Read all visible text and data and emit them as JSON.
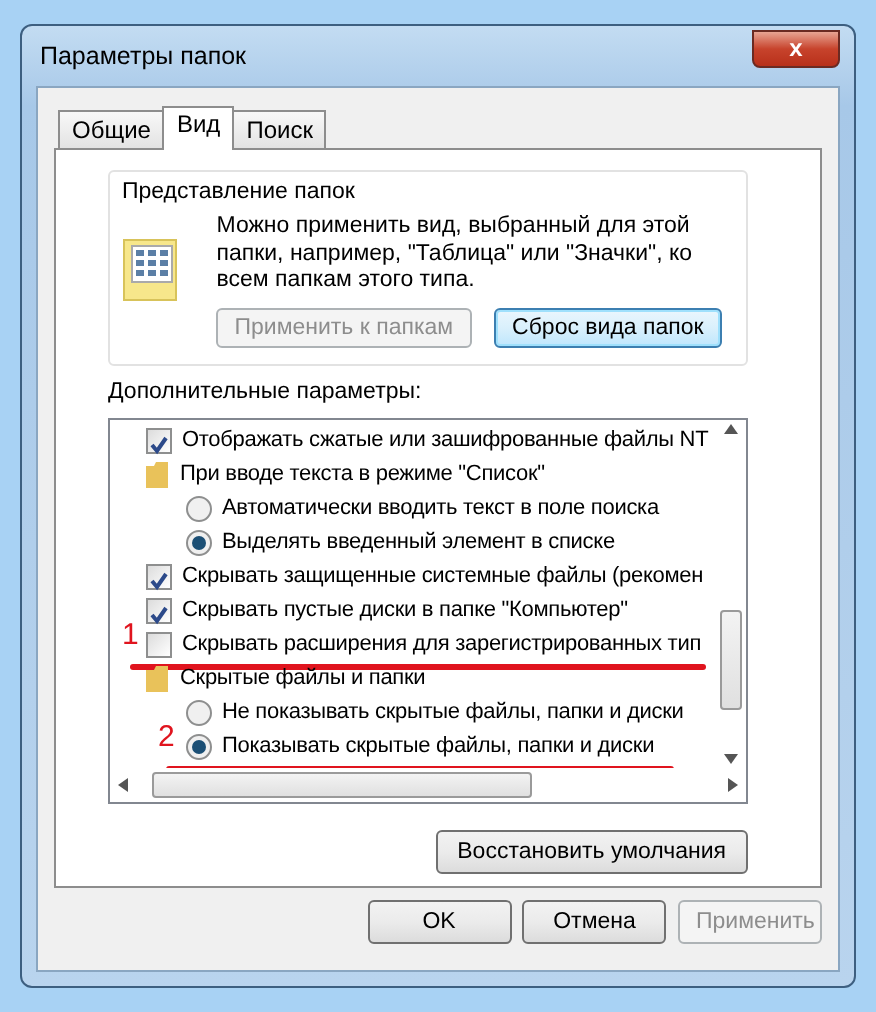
{
  "window": {
    "title": "Параметры папок",
    "close": "x"
  },
  "tabs": [
    {
      "label": "Общие",
      "selected": false
    },
    {
      "label": "Вид",
      "selected": true
    },
    {
      "label": "Поиск",
      "selected": false
    }
  ],
  "folder_views": {
    "title": "Представление папок",
    "text": "Можно применить вид, выбранный для этой папки, например, \"Таблица\" или \"Значки\", ко всем папкам этого типа.",
    "buttons": [
      {
        "label": "Применить к папкам",
        "disabled": true
      },
      {
        "label": "Сброс вида папок",
        "disabled": false
      }
    ]
  },
  "advanced": {
    "title": "Дополнительные параметры:",
    "items": [
      {
        "kind": "checkbox",
        "label": "Отображать сжатые или зашифрованные файлы NT",
        "checked": true
      },
      {
        "kind": "folder",
        "label": "При вводе текста в режиме \"Список\""
      },
      {
        "kind": "radio",
        "label": "Автоматически вводить текст в поле поиска",
        "selected": false
      },
      {
        "kind": "radio",
        "label": "Выделять введенный элемент в списке",
        "selected": true
      },
      {
        "kind": "checkbox",
        "label": "Скрывать защищенные системные файлы (рекомен",
        "checked": true
      },
      {
        "kind": "checkbox",
        "label": "Скрывать пустые диски в папке \"Компьютер\"",
        "checked": true
      },
      {
        "kind": "checkbox",
        "label": "Скрывать расширения для зарегистрированных тип",
        "checked": false,
        "annotation": "1"
      },
      {
        "kind": "folder",
        "label": "Скрытые файлы и папки"
      },
      {
        "kind": "radio",
        "label": "Не показывать скрытые файлы, папки и диски",
        "selected": false
      },
      {
        "kind": "radio",
        "label": "Показывать скрытые файлы, папки и диски",
        "selected": true,
        "annotation": "2"
      }
    ],
    "restore_button": "Восстановить умолчания"
  },
  "buttons": [
    {
      "label": "OK",
      "disabled": false
    },
    {
      "label": "Отмена",
      "disabled": false
    },
    {
      "label": "Применить",
      "disabled": true
    }
  ]
}
